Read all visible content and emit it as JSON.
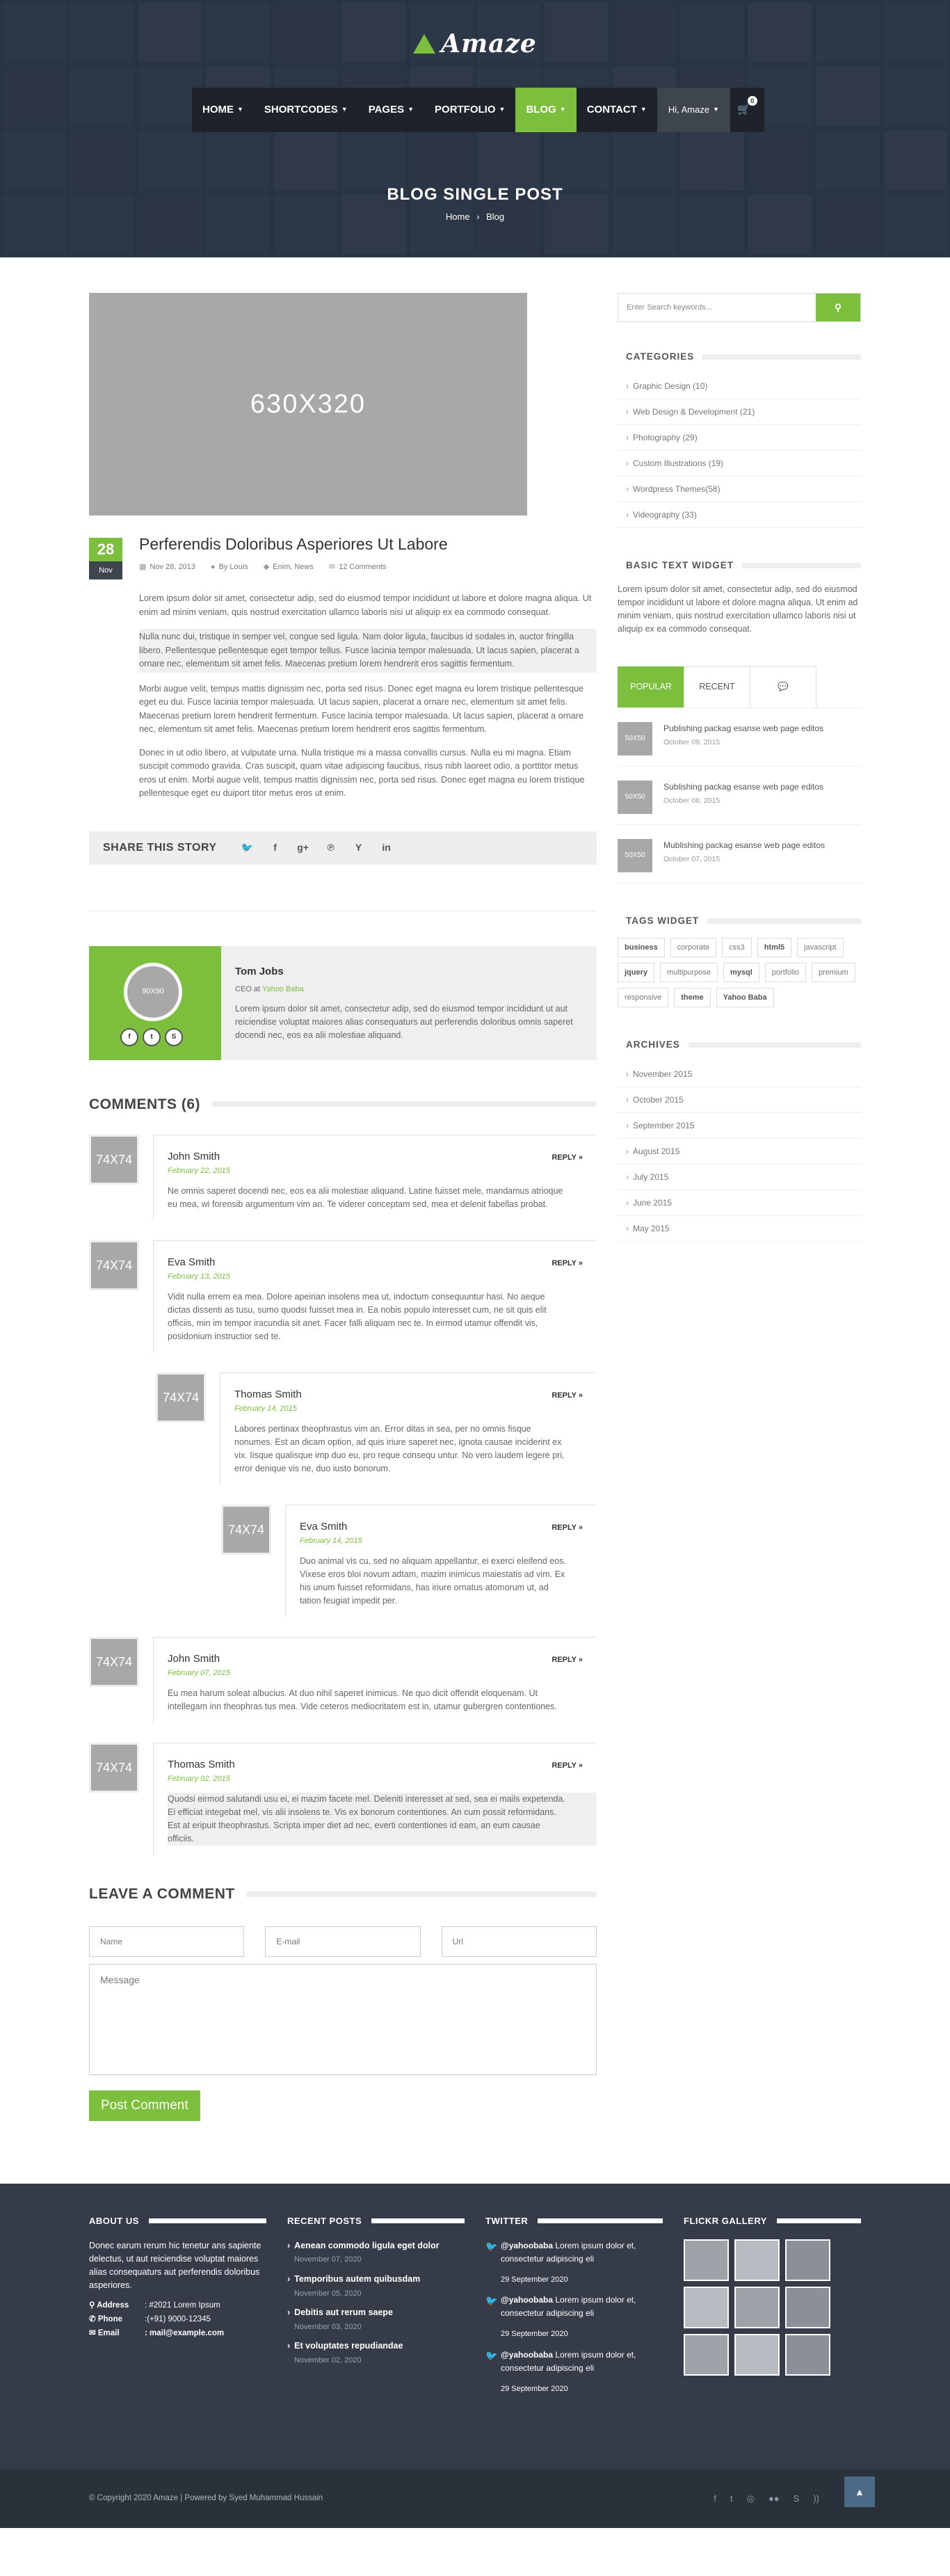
{
  "brand": {
    "logo_text": "Amaze",
    "accent": "#7cbf3c"
  },
  "nav": {
    "items": [
      {
        "label": "HOME"
      },
      {
        "label": "SHORTCODES"
      },
      {
        "label": "PAGES"
      },
      {
        "label": "PORTFOLIO"
      },
      {
        "label": "BLOG"
      },
      {
        "label": "CONTACT"
      }
    ],
    "user_label": "Hi, Amaze",
    "cart_count": "0"
  },
  "page": {
    "title": "BLOG SINGLE POST",
    "breadcrumb_home": "Home",
    "breadcrumb_sep": "›",
    "breadcrumb_current": "Blog"
  },
  "post": {
    "image_label": "630X320",
    "day": "28",
    "month": "Nov",
    "title": "Perferendis Doloribus Asperiores Ut Labore",
    "date": "Nov 28, 2013",
    "author": "By Louis",
    "tags": "Enim, News",
    "comments": "12 Comments",
    "paragraphs": [
      "Lorem ipsum dolor sit amet, consectetur adip, sed do eiusmod tempor incididunt ut labore et dolore magna aliqua. Ut enim ad minim veniam, quis nostrud exercitation ullamco laboris nisi ut aliquip ex ea commodo consequat.",
      "Nulla nunc dui, tristique in semper vel, congue sed ligula. Nam dolor ligula, faucibus id sodales in, auctor fringilla libero. Pellentesque pellentesque eget tempor tellus. Fusce lacinia tempor malesuada. Ut lacus sapien, placerat a ornare nec, elementum sit amet felis. Maecenas pretium lorem hendrerit eros sagittis fermentum.",
      "Morbi augue velit, tempus mattis dignissim nec, porta sed risus. Donec eget magna eu lorem tristique pellentesque eget eu dui. Fusce lacinia tempor malesuada. Ut lacus sapien, placerat a ornare nec, elementum sit amet felis. Maecenas pretium lorem hendrerit fermentum. Fusce lacinia tempor malesuada. Ut lacus sapien, placerat a ornare nec, elementum sit amet felis. Maecenas pretium lorem hendrerit eros sagittis fermentum.",
      "Donec in ut odio libero, at vulputate urna. Nulla tristique mi a massa convallis cursus. Nulla eu mi magna. Etiam suscipit commodo gravida. Cras suscipit, quam vitae adipiscing faucibus, risus nibh laoreet odio, a porttitor metus eros ut enim. Morbi augue velit, tempus mattis dignissim nec, porta sed risus. Donec eget magna eu lorem tristique pellentesque eget eu duiport titor metus eros ut enim."
    ]
  },
  "share": {
    "label": "SHARE THIS STORY",
    "icons": [
      "twitter-icon",
      "facebook-icon",
      "google-plus-icon",
      "pinterest-icon",
      "yahoo-icon",
      "linkedin-icon"
    ]
  },
  "author": {
    "avatar": "90X90",
    "name": "Tom Jobs",
    "role_prefix": "CEO at",
    "company": "Yahoo Baba",
    "bio": "Lorem ipsum dolor sit amet, consectetur adip, sed do eiusmod tempor incididunt ut aut reiciendise voluptat maiores alias consequaturs aut perferendis doloribus omnis saperet docendi nec, eos ea alii molestiae aliquand."
  },
  "comments_section": {
    "title": "COMMENTS (6)",
    "reply_label": "REPLY »",
    "avatar_label": "74X74",
    "items": [
      {
        "name": "John Smith",
        "date": "February 22, 2015",
        "text": "Ne omnis saperet docendi nec, eos ea alii molestiae aliquand. Latine fuisset mele, mandamus atrioque eu mea, wi forensib argumentum vim an. Te viderer conceptam sed, mea et delenit fabellas probat."
      },
      {
        "name": "Eva Smith",
        "date": "February 13, 2015",
        "text": "Vidit nulla errem ea mea. Dolore apeirian insolens mea ut, indoctum consequuntur hasi. No aeque dictas dissenti as tusu, sumo quodsi fuisset mea in. Ea nobis populo interesset cum, ne sit quis elit officiis, min im tempor iracundia sit anet. Facer falli aliquam nec te. In eirmod utamur offendit vis, posidonium instructior sed te."
      },
      {
        "name": "Thomas Smith",
        "date": "February 14, 2015",
        "text": "Labores pertinax theophrastus vim an. Error ditas in sea, per no omnis fisque nonumes. Est an dicam option, ad quis iriure saperet nec, ignota causae inciderint ex vix. Iisque qualisque imp duo eu, pro reque consequ untur. No vero laudem legere pri, error denique vis ne, duo iusto bonorum."
      },
      {
        "name": "Eva Smith",
        "date": "February 14, 2015",
        "text": "Duo animal vis cu, sed no aliquam appellantur, ei exerci eleifend eos. Vixese eros bloi novum adtam, mazim inimicus maiestatis ad vim. Ex his unum fuisset reformidans, has iriure ornatus atomorum ut, ad tation feugiat impedit per."
      },
      {
        "name": "John Smith",
        "date": "February 07, 2015",
        "text": "Eu mea harum soleat albucius. At duo nihil saperet inimicus. Ne quo dicit offendit eloquenam. Ut intellegam inn theophras tus mea. Vide ceteros mediocritatem est in, utamur gubergren contentiones."
      },
      {
        "name": "Thomas Smith",
        "date": "February 02, 2015",
        "text": "Quodsi eirmod salutandi usu ei, ei mazim facete mel. Deleniti interesset at sed, sea ei mails expetenda. Ei efficiat integebat mel, vis alii insolens te. Vis ex bonorum contentiones. An cum possit reformidans. Est at eripuit theophrastus. Scripta imper diet ad nec, everti contentiones id eam, an eum causae officiis."
      }
    ]
  },
  "leave_comment": {
    "title": "LEAVE A COMMENT",
    "name_ph": "Name",
    "email_ph": "E-mail",
    "url_ph": "Url",
    "message_ph": "Message",
    "button": "Post Comment"
  },
  "sidebar": {
    "search_ph": "Enter Search keywords...",
    "categories_title": "CATEGORIES",
    "categories": [
      "Graphic Design (10)",
      "Web Design & Development (21)",
      "Photography (29)",
      "Custom Illustrations (19)",
      "Wordpress Themes(58)",
      "Videography (33)"
    ],
    "text_title": "BASIC TEXT WIDGET",
    "text_body": "Lorem ipsum dolor sit amet, consectetur adip, sed do eiusmod tempor incididunt ut labore et dolore magna aliqua. Ut enim ad minim veniam, quis nostrud exercitation ullamco laboris nisi ut aliquip ex ea commodo consequat.",
    "tabs": [
      "POPULAR",
      "RECENT",
      "💬"
    ],
    "thumb_label": "50X50",
    "popular": [
      {
        "title": "Publishing packag esanse web page editos",
        "date": "October 09, 2015"
      },
      {
        "title": "Sublishing packag esanse web page editos",
        "date": "October 08, 2015"
      },
      {
        "title": "Mublishing packag esanse web page editos",
        "date": "October 07, 2015"
      }
    ],
    "tags_title": "TAGS WIDGET",
    "tags": [
      "business",
      "corporate",
      "css3",
      "html5",
      "javascript",
      "jquery",
      "multipurpose",
      "mysql",
      "portfolio",
      "premium",
      "responsive",
      "theme",
      "Yahoo Baba"
    ],
    "archives_title": "ARCHIVES",
    "archives": [
      "November 2015",
      "October 2015",
      "September 2015",
      "August 2015",
      "July 2015",
      "June 2015",
      "May 2015"
    ]
  },
  "footer": {
    "about_title": "ABOUT US",
    "about_text": "Donec earum rerum hic tenetur ans sapiente delectus, ut aut reiciendise voluptat maiores alias consequaturs aut perferendis doloribus asperiores.",
    "address_label": "Address",
    "address": ": #2021 Lorem Ipsum",
    "phone_label": "Phone",
    "phone": ":(+91) 9000-12345",
    "email_label": "Email",
    "email": ": mail@example.com",
    "recent_title": "RECENT POSTS",
    "recent": [
      {
        "title": "Aenean commodo ligula eget dolor",
        "date": "November 07, 2020"
      },
      {
        "title": "Temporibus autem quibusdam",
        "date": "November 05, 2020"
      },
      {
        "title": "Debitis aut rerum saepe",
        "date": "November 03, 2020"
      },
      {
        "title": "Et voluptates repudiandae",
        "date": "November 02, 2020"
      }
    ],
    "twitter_title": "TWITTER",
    "tweets": [
      {
        "handle": "@yahoobaba",
        "text": " Lorem ipsum dolor et, consectetur adipiscing eli",
        "date": "29 September 2020"
      },
      {
        "handle": "@yahoobaba",
        "text": " Lorem ipsum dolor et, consectetur adipiscing eli",
        "date": "29 September 2020"
      },
      {
        "handle": "@yahoobaba",
        "text": " Lorem ipsum dolor et, consectetur adipiscing eli",
        "date": "29 September 2020"
      }
    ],
    "flickr_title": "FLICKR GALLERY",
    "copyright": "© Copyright 2020 Amaze | Powered by Syed Muhammad Hussain",
    "social_icons": [
      "facebook-icon",
      "twitter-icon",
      "dribbble-icon",
      "flickr-icon",
      "skype-icon",
      "rss-icon"
    ]
  }
}
